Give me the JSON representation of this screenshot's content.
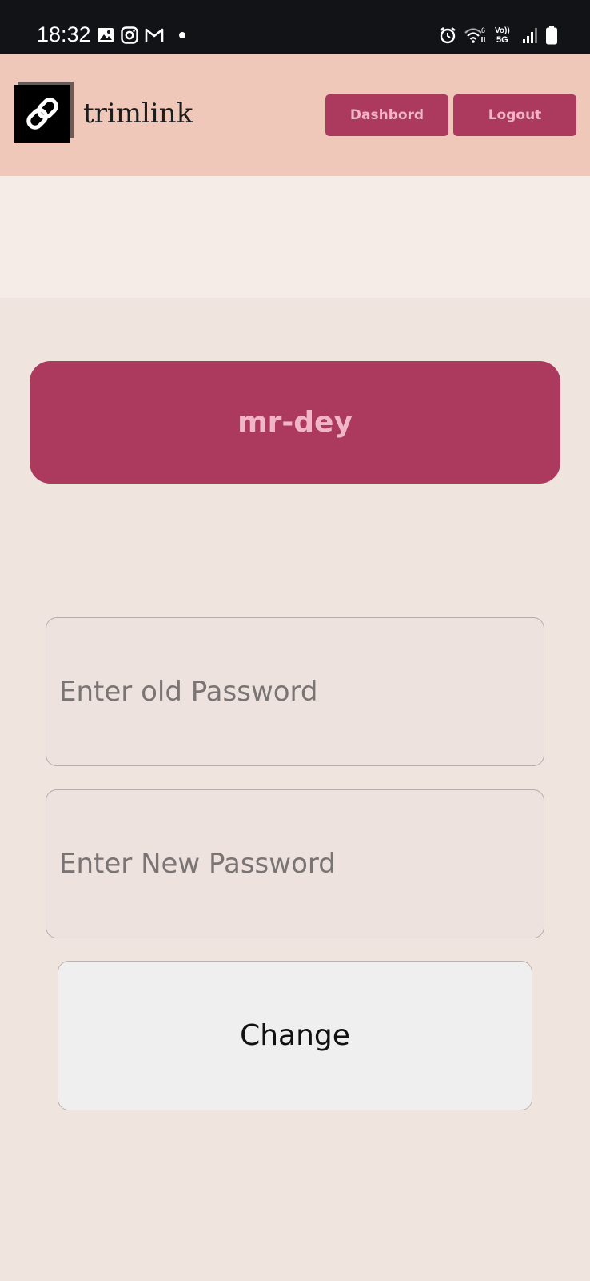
{
  "status_bar": {
    "time": "18:32",
    "left_icons": [
      "gallery-icon",
      "instagram-icon",
      "gmail-icon",
      "notification-dot-icon"
    ],
    "right_icons": [
      "alarm-icon",
      "wifi-icon",
      "volte-5g-icon",
      "signal-icon",
      "battery-icon"
    ]
  },
  "header": {
    "brand": "trimlink",
    "logo_icon": "link-icon",
    "dashboard_label": "Dashbord",
    "logout_label": "Logout"
  },
  "user_card": {
    "username": "mr-dey"
  },
  "form": {
    "old_password_placeholder": "Enter old Password",
    "new_password_placeholder": "Enter New Password",
    "submit_label": "Change"
  },
  "colors": {
    "header_bg": "#efc8ba",
    "accent": "#ab3a5e",
    "accent_text": "#f0b5c6",
    "page_bg": "#f0e4df"
  }
}
